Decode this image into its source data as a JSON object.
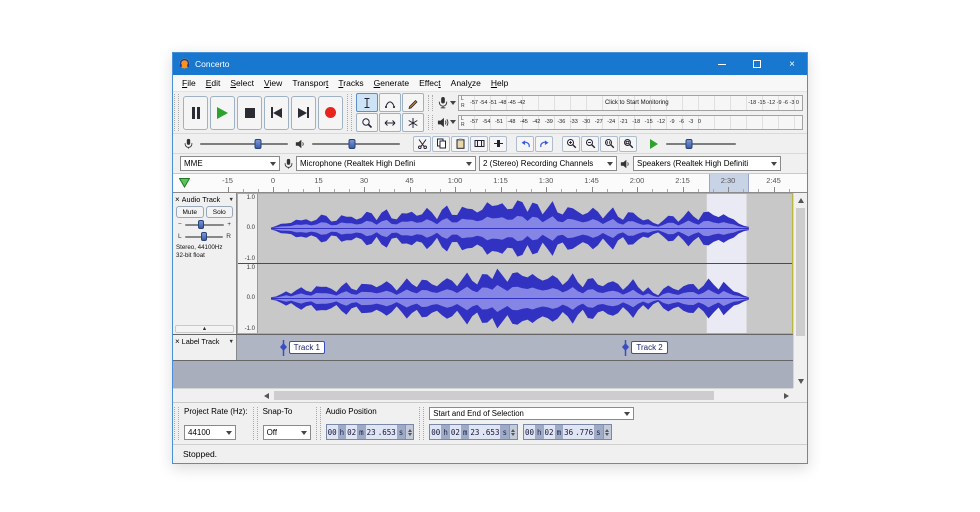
{
  "colors": {
    "accent": "#1877cf",
    "waveform": "#3232c2",
    "waveform_light": "#8585e6",
    "selection": "#eaeaf4",
    "ruler_selection": "#c9d3e6",
    "track_border": "#b8b83c"
  },
  "titlebar": {
    "title": "Concerto",
    "close_glyph": "×"
  },
  "menu": {
    "items": [
      {
        "label": "File",
        "u": 0
      },
      {
        "label": "Edit",
        "u": 0
      },
      {
        "label": "Select",
        "u": 0
      },
      {
        "label": "View",
        "u": 0
      },
      {
        "label": "Transport",
        "u": 8
      },
      {
        "label": "Tracks",
        "u": 0
      },
      {
        "label": "Generate",
        "u": 0
      },
      {
        "label": "Effect",
        "u": 5
      },
      {
        "label": "Analyze",
        "u": 4
      },
      {
        "label": "Help",
        "u": 0
      }
    ]
  },
  "meters": {
    "recording": {
      "l": "L",
      "r": "R",
      "left": "-57 -54 -51 -48 -45 -42",
      "message": "Click to Start Monitoring",
      "right": "-18 -15 -12 -9 -6 -3 0"
    },
    "playback": {
      "l": "L",
      "r": "R",
      "scale": "-57 -54 -51 -48 -45 -42 -39 -36 -33 -30 -27 -24 -21 -18 -15 -12 -9 -6 -3 0"
    }
  },
  "sliders": {
    "recording_volume": 0.66,
    "playback_volume": 0.45,
    "play_speed": 0.33
  },
  "track_sliders": {
    "gain": 0.42,
    "pan": 0.5
  },
  "device": {
    "host": "MME",
    "recording_device": "Microphone (Realtek High Defini",
    "channels": "2 (Stereo) Recording Channels",
    "playback_device": "Speakers (Realtek High Definiti"
  },
  "timeline": {
    "labels": [
      "-15",
      "0",
      "15",
      "30",
      "45",
      "1:00",
      "1:15",
      "1:30",
      "1:45",
      "2:00",
      "2:15",
      "2:30",
      "2:45"
    ],
    "selection_start_s": 143.653,
    "selection_end_s": 156.776
  },
  "audio_track": {
    "panel": {
      "close": "×",
      "title": "Audio Track",
      "dropdown": "▼",
      "mute": "Mute",
      "solo": "Solo",
      "gain_min": "−",
      "gain_max": "+",
      "pan_left": "L",
      "pan_right": "R",
      "info_line1": "Stereo, 44100Hz",
      "info_line2": "32-bit float",
      "collapse": "▲"
    },
    "vruler": [
      "1.0",
      "0.0",
      "-1.0"
    ]
  },
  "label_track": {
    "panel": {
      "close": "×",
      "title": "Label Track",
      "dropdown": "▼"
    },
    "labels": [
      {
        "text": "Track 1",
        "time_s": 3.5
      },
      {
        "text": "Track 2",
        "time_s": 116.5
      }
    ]
  },
  "waveform": {
    "duration_s": 157.5,
    "envelope": [
      0.04,
      0.08,
      0.15,
      0.22,
      0.18,
      0.28,
      0.35,
      0.3,
      0.22,
      0.38,
      0.45,
      0.4,
      0.3,
      0.25,
      0.42,
      0.5,
      0.38,
      0.28,
      0.45,
      0.55,
      0.48,
      0.35,
      0.52,
      0.6,
      0.42,
      0.3,
      0.48,
      0.62,
      0.55,
      0.4,
      0.58,
      0.68,
      0.5,
      0.38,
      0.62,
      0.72,
      0.55,
      0.45,
      0.68,
      0.8,
      0.65,
      0.5,
      0.75,
      0.88,
      0.7,
      0.92,
      0.85,
      0.6,
      0.78,
      0.95,
      0.82,
      0.65,
      0.88,
      0.75,
      0.55,
      0.7,
      0.85,
      0.62,
      0.48,
      0.66,
      0.78,
      0.58,
      0.42,
      0.6,
      0.72,
      0.52,
      0.38,
      0.55,
      0.65,
      0.45,
      0.3,
      0.5,
      0.6,
      0.4,
      0.25,
      0.35,
      0.2,
      0.12,
      0.3,
      0.45,
      0.38,
      0.25,
      0.42,
      0.55,
      0.45,
      0.3,
      0.5,
      0.62,
      0.48,
      0.35,
      0.52,
      0.4,
      0.28,
      0.18,
      0.1,
      0.05
    ]
  },
  "selection_toolbar": {
    "project_rate_label": "Project Rate (Hz):",
    "project_rate_value": "44100",
    "snap_label": "Snap-To",
    "snap_value": "Off",
    "audio_position_label": "Audio Position",
    "selection_mode_label": "Start and End of Selection",
    "audio_position_parts": [
      "00",
      "h",
      "02",
      "m",
      "23",
      ".653",
      "s"
    ],
    "selection_start_parts": [
      "00",
      "h",
      "02",
      "m",
      "23",
      ".653",
      "s"
    ],
    "selection_end_parts": [
      "00",
      "h",
      "02",
      "m",
      "36",
      ".776",
      "s"
    ]
  },
  "statusbar": {
    "text": "Stopped."
  }
}
